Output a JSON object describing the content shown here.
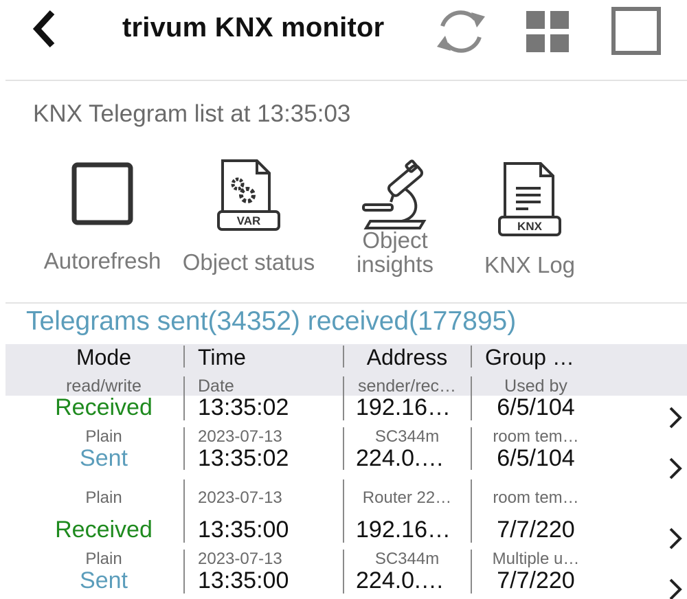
{
  "header": {
    "title": "trivum KNX monitor",
    "icons": [
      "back-chevron-icon",
      "refresh-icon",
      "grid-icon",
      "square-icon"
    ]
  },
  "list_title": "KNX Telegram list at 13:35:03",
  "toolbar": [
    {
      "label": "Autorefresh",
      "icon": "checkbox-square-icon"
    },
    {
      "label": "Object status",
      "icon": "var-file-icon",
      "badge": "VAR"
    },
    {
      "label_line1": "Object",
      "label_line2": "insights",
      "icon": "microscope-icon"
    },
    {
      "label": "KNX Log",
      "icon": "knx-file-icon",
      "badge": "KNX"
    }
  ],
  "counts": "Telegrams sent(34352) received(177895)",
  "table": {
    "headers": [
      "Mode",
      "Time",
      "Address",
      "Group …"
    ],
    "subheaders": [
      "read/write",
      "Date",
      "sender/rec…",
      "Used by"
    ],
    "rows": [
      {
        "mode": "Received",
        "time": "13:35:02",
        "address": "192.16…",
        "group": "6/5/104",
        "rw": "Plain",
        "date": "2023-07-13",
        "sender": "SC344m",
        "used_by": "room tem…"
      },
      {
        "mode": "Sent",
        "time": "13:35:02",
        "address": "224.0.…",
        "group": "6/5/104",
        "rw": "Plain",
        "date": "2023-07-13",
        "sender": "Router 22…",
        "used_by": "room tem…"
      },
      {
        "mode": "Received",
        "time": "13:35:00",
        "address": "192.16…",
        "group": "7/7/220",
        "rw": "Plain",
        "date": "2023-07-13",
        "sender": "SC344m",
        "used_by": "Multiple u…"
      },
      {
        "mode": "Sent",
        "time": "13:35:00",
        "address": "224.0.…",
        "group": "7/7/220"
      }
    ]
  },
  "colors": {
    "accent_blue": "#5b9dbb",
    "received_green": "#1e8a1e",
    "icon_gray": "#777777",
    "header_band": "#e9e9ee"
  }
}
